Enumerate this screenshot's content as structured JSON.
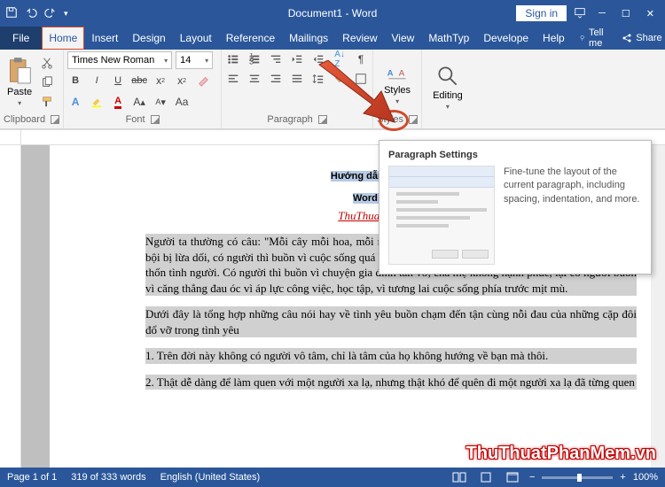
{
  "title": "Document1 - Word",
  "signin": "Sign in",
  "tabs": {
    "file": "File",
    "home": "Home",
    "insert": "Insert",
    "design": "Design",
    "layout": "Layout",
    "references": "Reference",
    "mailings": "Mailings",
    "review": "Review",
    "view": "View",
    "mathtype": "MathTyp",
    "developer": "Develope",
    "help": "Help",
    "tellme": "Tell me",
    "share": "Share"
  },
  "groups": {
    "clipboard": "Clipboard",
    "font": "Font",
    "paragraph": "Paragraph",
    "styles": "Styles",
    "editing": "Editing"
  },
  "pasteLabel": "Paste",
  "font": {
    "name": "Times New Roman",
    "size": "14"
  },
  "stylesBtn": "Styles",
  "editingBtn": "Editing",
  "tooltip": {
    "title": "Paragraph Settings",
    "body": "Fine-tune the layout of the current paragraph, including spacing, indentation, and more."
  },
  "doc": {
    "heading": "Hướng dẫn cách chỉnh khoảng cách dòng trong Word 2007, 2010, 2013, 2016",
    "headingShown1": "Hướng dẫn cách chỉnh kh",
    "headingShown2": "Word 2007, 2010",
    "subtitle": "ThuThuatPhanMem.vn",
    "p1": "Người ta thường có câu: \"Mỗi cây mỗi hoa, mỗi nhà mỗi cảnh\". Có người thất vọng vì tình yêu bị phản bội bị lừa dối, có người thì buồn vì cuộc sống quá bon chen, lạc lõng giữa dòng người tấp nập nhưng thiếu thốn tình người. Có người thì buồn vì chuyện gia đình tan vỡ, cha mẹ không hạnh phúc, lại có người buồn vì căng thẳng đau óc vì áp lực công việc, học tập, vì tương lai cuộc sống phía trước mịt mù.",
    "p2": "Dưới đây là tổng hợp những câu nói hay về tình yêu buồn chạm đến tận cùng nỗi đau của những cặp đôi đổ vỡ trong tình yêu",
    "p3": "1. Trên đời này không có người vô tâm, chỉ là tâm của họ không hướng về bạn mà thôi.",
    "p4": "2. Thật dễ dàng để làm quen với một người xa lạ, nhưng thật khó để quên đi một người xa lạ đã từng quen"
  },
  "status": {
    "page": "Page 1 of 1",
    "words": "319 of 333 words",
    "lang": "English (United States)",
    "zoom": "100%"
  },
  "watermark": "ThuThuatPhanMem.vn"
}
